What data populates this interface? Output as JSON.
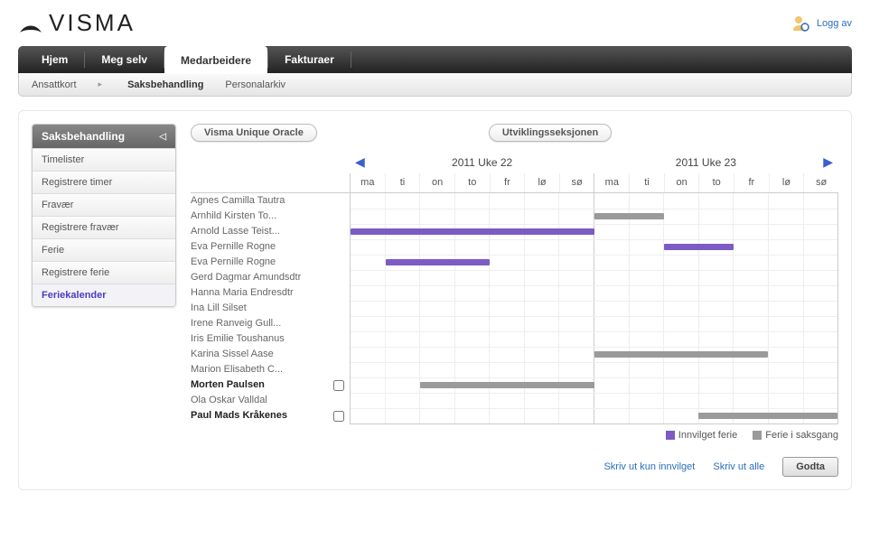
{
  "brand": "VISMA",
  "header": {
    "logout": "Logg av"
  },
  "nav": {
    "main": [
      "Hjem",
      "Meg selv",
      "Medarbeidere",
      "Fakturaer"
    ],
    "mainActive": 2,
    "sub": [
      "Ansattkort",
      "Saksbehandling",
      "Personalarkiv"
    ],
    "subActive": 1
  },
  "sidebar": {
    "title": "Saksbehandling",
    "items": [
      "Timelister",
      "Registrere timer",
      "Fravær",
      "Registrere fravær",
      "Ferie",
      "Registrere ferie",
      "Feriekalender"
    ],
    "activeIndex": 6
  },
  "selectors": {
    "org": "Visma Unique Oracle",
    "dept": "Utviklingsseksjonen"
  },
  "weeks": {
    "left": "2011 Uke 22",
    "right": "2011 Uke 23"
  },
  "days": [
    "ma",
    "ti",
    "on",
    "to",
    "fr",
    "lø",
    "sø",
    "ma",
    "ti",
    "on",
    "to",
    "fr",
    "lø",
    "sø"
  ],
  "employees": [
    {
      "name": "Agnes Camilla Tautra",
      "bold": false,
      "checkbox": false,
      "bars": []
    },
    {
      "name": "Arnhild Kirsten To...",
      "bold": false,
      "checkbox": false,
      "bars": [
        {
          "start": 7,
          "span": 2,
          "type": "pending"
        }
      ]
    },
    {
      "name": "Arnold Lasse Teist...",
      "bold": false,
      "checkbox": false,
      "bars": [
        {
          "start": 0,
          "span": 7,
          "type": "approved"
        }
      ]
    },
    {
      "name": "Eva Pernille Rogne",
      "bold": false,
      "checkbox": false,
      "bars": [
        {
          "start": 9,
          "span": 2,
          "type": "approved"
        }
      ]
    },
    {
      "name": "Eva Pernille Rogne",
      "bold": false,
      "checkbox": false,
      "bars": [
        {
          "start": 1,
          "span": 3,
          "type": "approved"
        }
      ]
    },
    {
      "name": "Gerd Dagmar Amundsdtr",
      "bold": false,
      "checkbox": false,
      "bars": []
    },
    {
      "name": "Hanna Maria Endresdtr",
      "bold": false,
      "checkbox": false,
      "bars": []
    },
    {
      "name": "Ina Lill Silset",
      "bold": false,
      "checkbox": false,
      "bars": []
    },
    {
      "name": "Irene Ranveig Gull...",
      "bold": false,
      "checkbox": false,
      "bars": []
    },
    {
      "name": "Iris Emilie Toushanus",
      "bold": false,
      "checkbox": false,
      "bars": []
    },
    {
      "name": "Karina Sissel Aase",
      "bold": false,
      "checkbox": false,
      "bars": [
        {
          "start": 7,
          "span": 5,
          "type": "pending"
        }
      ]
    },
    {
      "name": "Marion Elisabeth C...",
      "bold": false,
      "checkbox": false,
      "bars": []
    },
    {
      "name": "Morten Paulsen",
      "bold": true,
      "checkbox": true,
      "bars": [
        {
          "start": 2,
          "span": 5,
          "type": "pending"
        }
      ]
    },
    {
      "name": "Ola Oskar Valldal",
      "bold": false,
      "checkbox": false,
      "bars": []
    },
    {
      "name": "Paul Mads Kråkenes",
      "bold": true,
      "checkbox": true,
      "bars": [
        {
          "start": 10,
          "span": 4,
          "type": "pending"
        }
      ]
    }
  ],
  "legend": {
    "approved": "Innvilget ferie",
    "pending": "Ferie i saksgang"
  },
  "actions": {
    "printApproved": "Skriv ut kun innvilget",
    "printAll": "Skriv ut alle",
    "accept": "Godta"
  },
  "colors": {
    "approved": "#7c5bc4",
    "pending": "#9a9a9a"
  }
}
